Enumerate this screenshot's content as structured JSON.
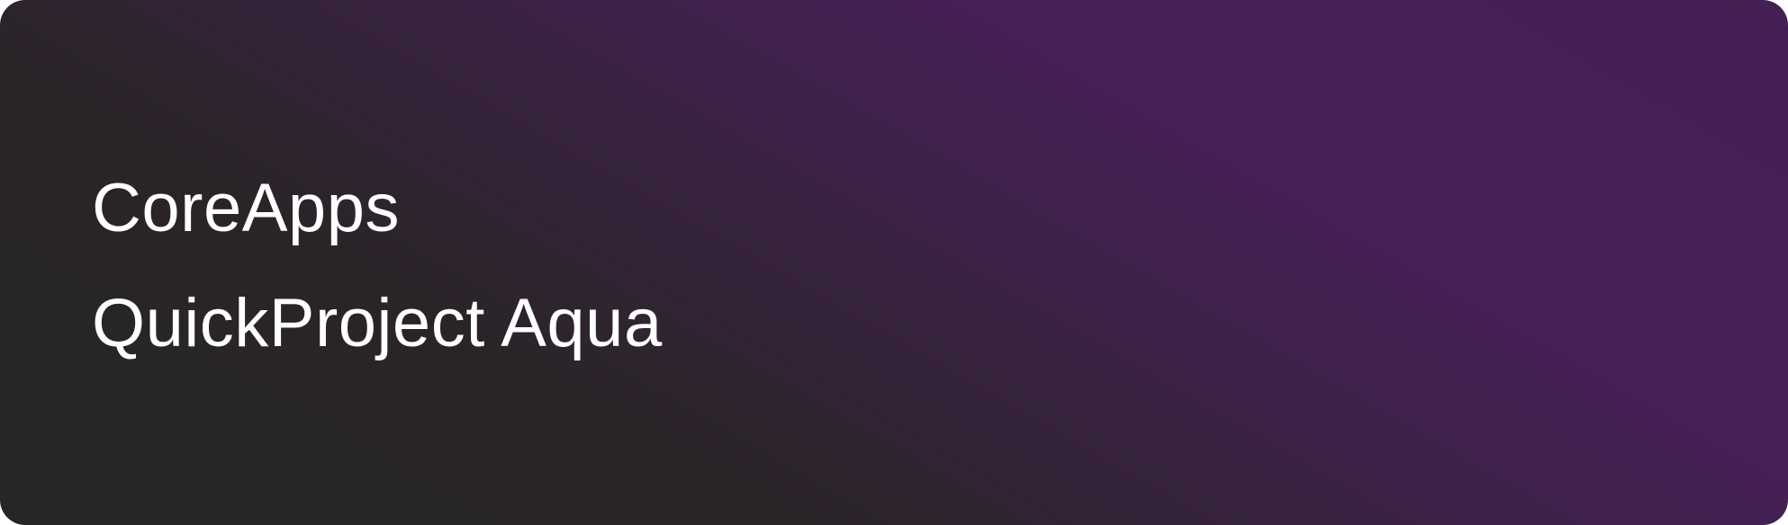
{
  "banner": {
    "line1": "CoreApps",
    "line2": "QuickProject Aqua"
  },
  "colors": {
    "background_start": "#262626",
    "background_end": "#47205a",
    "text": "#ffffff"
  }
}
